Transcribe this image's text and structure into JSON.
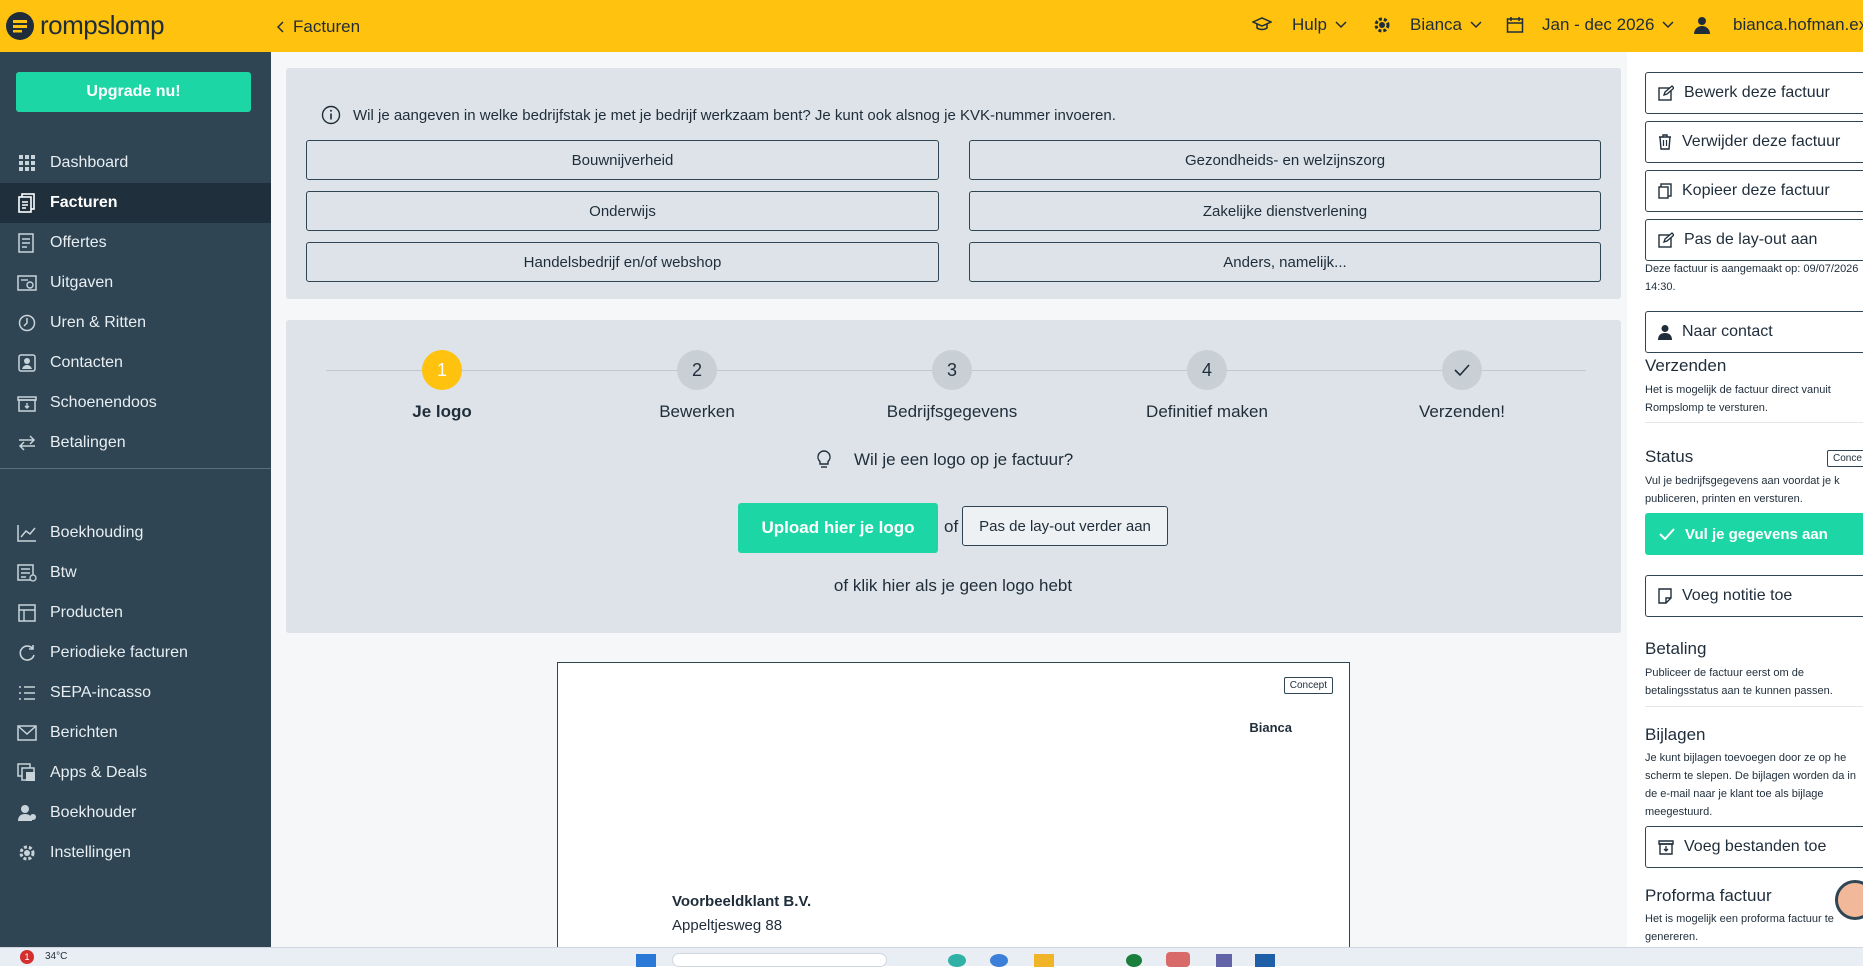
{
  "app": {
    "name": "rompslomp"
  },
  "topbar": {
    "breadcrumb": "Facturen",
    "help_label": "Hulp",
    "company_label": "Bianca",
    "period_label": "Jan - dec 2026",
    "user_label": "bianca.hofman.ext..."
  },
  "sidebar": {
    "upgrade_label": "Upgrade nu!",
    "items": [
      {
        "label": "Dashboard",
        "icon": "grid-icon"
      },
      {
        "label": "Facturen",
        "icon": "invoice-icon",
        "active": true
      },
      {
        "label": "Offertes",
        "icon": "quote-icon"
      },
      {
        "label": "Uitgaven",
        "icon": "expenses-icon"
      },
      {
        "label": "Uren & Ritten",
        "icon": "clock-icon"
      },
      {
        "label": "Contacten",
        "icon": "contact-icon"
      },
      {
        "label": "Schoenendoos",
        "icon": "box-icon"
      },
      {
        "label": "Betalingen",
        "icon": "transfer-icon"
      }
    ],
    "items2": [
      {
        "label": "Boekhouding",
        "icon": "chart-icon"
      },
      {
        "label": "Btw",
        "icon": "tax-icon"
      },
      {
        "label": "Producten",
        "icon": "product-icon"
      },
      {
        "label": "Periodieke facturen",
        "icon": "refresh-icon"
      },
      {
        "label": "SEPA-incasso",
        "icon": "list-icon"
      },
      {
        "label": "Berichten",
        "icon": "mail-icon"
      },
      {
        "label": "Apps & Deals",
        "icon": "apps-icon"
      },
      {
        "label": "Boekhouder",
        "icon": "accountant-icon"
      },
      {
        "label": "Instellingen",
        "icon": "gear-icon"
      }
    ]
  },
  "sector_panel": {
    "question": "Wil je aangeven in welke bedrijfstak je met je bedrijf werkzaam bent? Je kunt ook alsnog je KVK-nummer invoeren.",
    "options": [
      "Bouwnijverheid",
      "Gezondheids- en welzijnszorg",
      "Onderwijs",
      "Zakelijke dienstverlening",
      "Handelsbedrijf en/of webshop",
      "Anders, namelijk..."
    ]
  },
  "wizard": {
    "steps": [
      {
        "num": "1",
        "label": "Je logo",
        "active": true
      },
      {
        "num": "2",
        "label": "Bewerken"
      },
      {
        "num": "3",
        "label": "Bedrijfsgegevens"
      },
      {
        "num": "4",
        "label": "Definitief maken"
      },
      {
        "num": "",
        "label": "Verzenden!"
      }
    ],
    "question": "Wil je een logo op je factuur?",
    "upload_label": "Upload hier je logo",
    "of_label": "of",
    "layout_label": "Pas de lay-out verder aan",
    "nologo_label": "of klik hier als je geen logo hebt"
  },
  "invoice": {
    "badge": "Concept",
    "company": "Bianca",
    "client_name": "Voorbeeldklant B.V.",
    "client_street": "Appeltjesweg 88"
  },
  "right": {
    "edit_label": "Bewerk deze factuur",
    "delete_label": "Verwijder deze factuur",
    "copy_label": "Kopieer deze factuur",
    "layout_label": "Pas de lay-out aan",
    "created_text": "Deze factuur is aangemaakt op: 09/07/2026 14:30.",
    "contact_label": "Naar contact",
    "send_title": "Verzenden",
    "send_text": "Het is mogelijk de factuur direct vanuit Rompslomp te versturen.",
    "status_title": "Status",
    "status_badge": "Conce",
    "status_text": "Vul je bedrijfsgegevens aan voordat je k publiceren, printen en versturen.",
    "fill_label": "Vul je gegevens aan",
    "note_label": "Voeg notitie toe",
    "payment_title": "Betaling",
    "payment_text": "Publiceer de factuur eerst om de betalingsstatus aan te kunnen passen.",
    "attach_title": "Bijlagen",
    "attach_text": "Je kunt bijlagen toevoegen door ze op he scherm te slepen. De bijlagen worden da in de e-mail naar je klant toe als bijlage meegestuurd.",
    "files_label": "Voeg bestanden toe",
    "proforma_title": "Proforma factuur",
    "proforma_text": "Het is mogelijk een proforma factuur te genereren."
  },
  "taskbar": {
    "weather": "34°C",
    "notif": "1"
  },
  "colors": {
    "accent_yellow": "#ffc20e",
    "accent_green": "#1dd6a6",
    "sidebar": "#2f4553"
  }
}
